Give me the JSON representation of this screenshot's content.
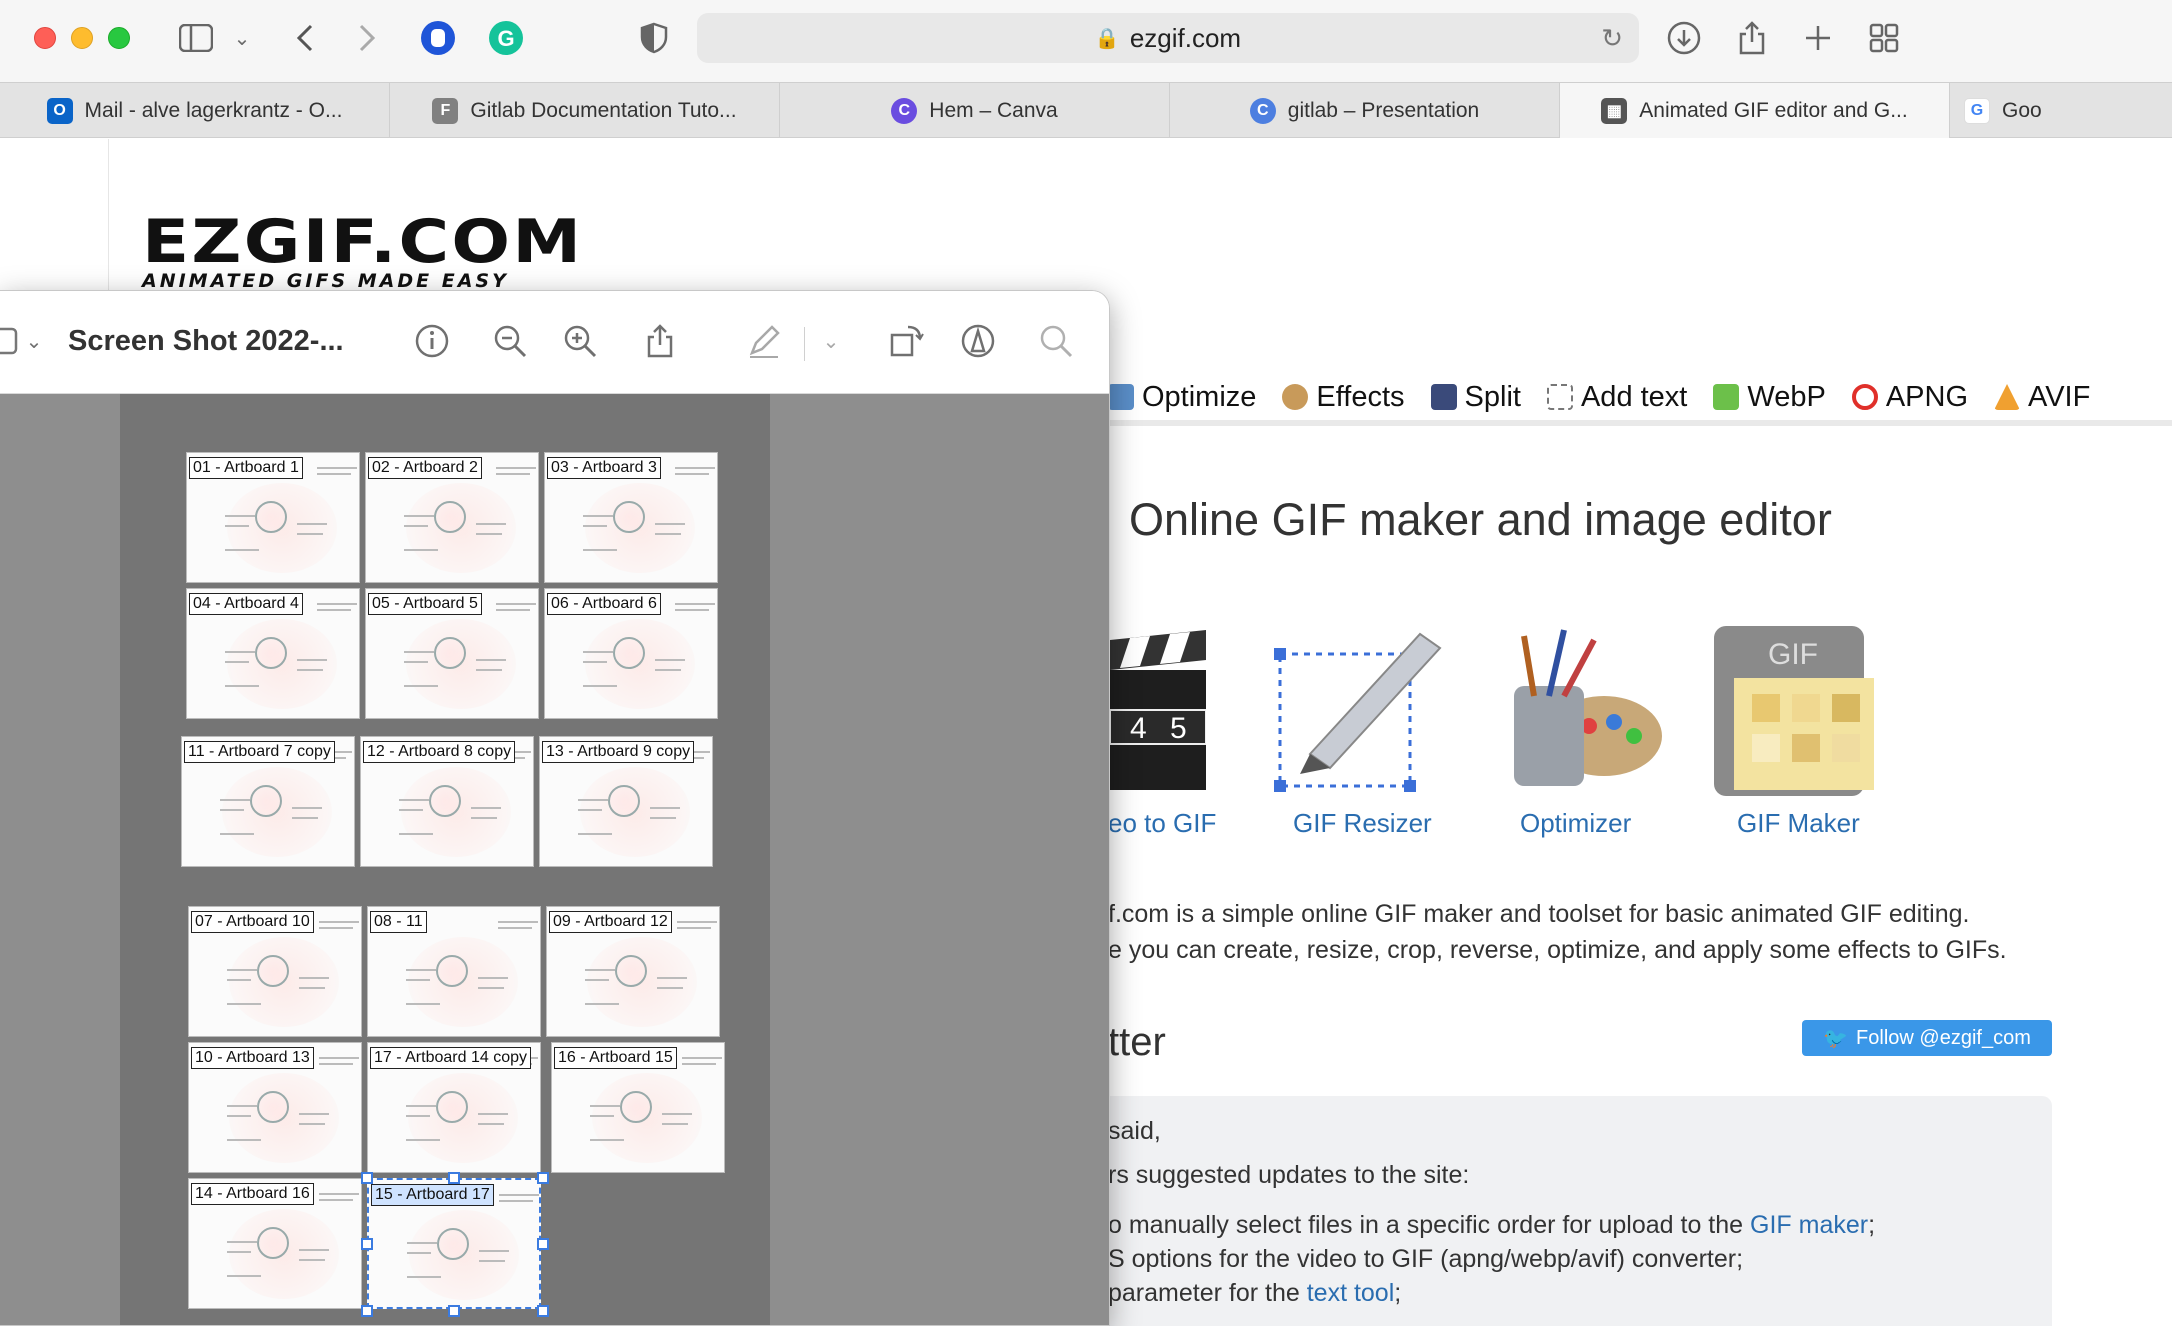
{
  "browser": {
    "url": "ezgif.com",
    "tabs": [
      {
        "label": "Mail - alve lagerkrantz - O...",
        "icon": "outlook-icon",
        "color": "#0a64c8"
      },
      {
        "label": "Gitlab Documentation Tuto...",
        "icon": "f-icon",
        "color": "#808080"
      },
      {
        "label": "Hem – Canva",
        "icon": "canva-icon",
        "color": "#6a4de0"
      },
      {
        "label": "gitlab – Presentation",
        "icon": "canva-icon",
        "color": "#4d7fe0"
      },
      {
        "label": "Animated GIF editor and G...",
        "icon": "ezgif-icon",
        "color": "#555555"
      },
      {
        "label": "Goo",
        "icon": "google-icon",
        "color": "#4285f4"
      }
    ]
  },
  "site": {
    "logo_main": "EZGIF.COM",
    "logo_sub": "ANIMATED GIFS MADE EASY",
    "nav": [
      {
        "label": "Optimize",
        "color": "#5a8ec8"
      },
      {
        "label": "Effects",
        "color": "#c89a5a"
      },
      {
        "label": "Split",
        "color": "#3a4a7a"
      },
      {
        "label": "Add text",
        "color": "#7a7a7a"
      },
      {
        "label": "WebP",
        "color": "#6cc04a"
      },
      {
        "label": "APNG",
        "color": "#e0302a"
      },
      {
        "label": "AVIF",
        "color": "#f0a030"
      }
    ],
    "headline": "Online GIF maker and image editor",
    "tools": [
      "eo to GIF",
      "GIF Resizer",
      "Optimizer",
      "GIF Maker"
    ],
    "desc_line1": "f.com is a simple online GIF maker and toolset for basic animated GIF editing.",
    "desc_line2": "e you can create, resize, crop, reverse, optimize, and apply some effects to GIFs.",
    "news_heading": "tter",
    "follow_label": "Follow @ezgif_com",
    "news_said": "said,",
    "news_intro": "rs suggested updates to the site:",
    "news_items": [
      {
        "pre": "o manually select files in a specific order for upload to the ",
        "link": "GIF maker",
        "post": ";"
      },
      {
        "pre": "S options for the video to GIF (apng/webp/avif) converter;",
        "link": "",
        "post": ""
      },
      {
        "pre": "parameter for the ",
        "link": "text tool",
        "post": ";"
      }
    ]
  },
  "preview": {
    "title": "Screen Shot 2022-...",
    "slides": [
      {
        "label": "01 - Artboard 1"
      },
      {
        "label": "02 - Artboard 2"
      },
      {
        "label": "03 - Artboard 3"
      },
      {
        "label": "04 - Artboard 4"
      },
      {
        "label": "05 - Artboard 5"
      },
      {
        "label": "06 - Artboard 6"
      },
      {
        "label": "11 - Artboard 7 copy"
      },
      {
        "label": "12 - Artboard 8 copy"
      },
      {
        "label": "13 - Artboard 9 copy"
      },
      {
        "label": "07 - Artboard 10"
      },
      {
        "label": "08 - 11"
      },
      {
        "label": "09 - Artboard 12"
      },
      {
        "label": "10 - Artboard 13"
      },
      {
        "label": "17 - Artboard 14 copy"
      },
      {
        "label": "16 - Artboard 15"
      },
      {
        "label": "14 - Artboard 16"
      },
      {
        "label": "15 - Artboard 17"
      }
    ]
  }
}
